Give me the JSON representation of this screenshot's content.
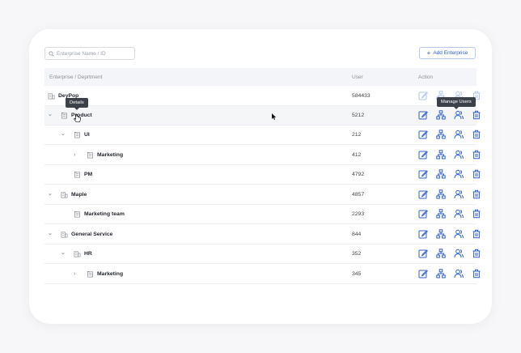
{
  "search": {
    "placeholder": "Enterprise Name / ID",
    "value": ""
  },
  "toolbar": {
    "add_label": "Add Enterprise"
  },
  "table": {
    "headers": {
      "name": "Enterprise / Deprtment",
      "user": "User",
      "action": "Action"
    },
    "rows": [
      {
        "name": "DeyPop",
        "user": "584433"
      },
      {
        "name": "Product",
        "user": "5212"
      },
      {
        "name": "UI",
        "user": "212"
      },
      {
        "name": "Marketing",
        "user": "412"
      },
      {
        "name": "PM",
        "user": "4792"
      },
      {
        "name": "Maple",
        "user": "4857"
      },
      {
        "name": "Marketing team",
        "user": "2293"
      },
      {
        "name": "General Service",
        "user": "844"
      },
      {
        "name": "HR",
        "user": "352"
      },
      {
        "name": "Marketing",
        "user": "345"
      }
    ]
  },
  "tooltips": {
    "details": "Details",
    "manage_users": "Manage Users"
  },
  "colors": {
    "accent": "#2f5fd0",
    "tooltip_bg": "#3b4049",
    "header_bg": "#f4f5f8"
  },
  "icons": [
    "search-icon",
    "plus-icon",
    "building-icon",
    "chevron-down-icon",
    "chevron-right-icon",
    "edit-icon",
    "org-structure-icon",
    "manage-users-icon",
    "delete-icon"
  ]
}
